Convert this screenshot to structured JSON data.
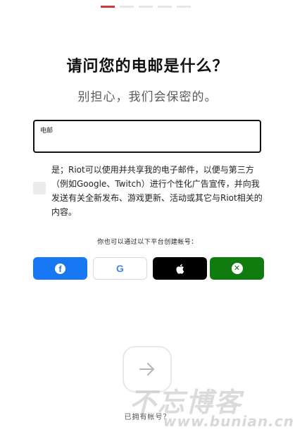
{
  "progress": {
    "total_steps": 5,
    "current_step": 1
  },
  "header": {
    "title": "请问您的电邮是什么？",
    "subtitle": "别担心，我们会保密的。"
  },
  "email": {
    "label": "电邮",
    "value": ""
  },
  "consent": {
    "checked": false,
    "text": "是；Riot可以使用并共享我的电子邮件，以便与第三方（例如Google、Twitch）进行个性化广告宣传，并向我发送有关全新发布、游戏更新、活动或其它与Riot相关的内容。"
  },
  "social": {
    "label": "你也可以通过以下平台创建帐号：",
    "providers": [
      {
        "name": "facebook",
        "icon": "facebook-icon",
        "color": "#1877f2"
      },
      {
        "name": "google",
        "icon": "google-icon",
        "color": "#ffffff"
      },
      {
        "name": "apple",
        "icon": "apple-icon",
        "color": "#000000"
      },
      {
        "name": "xbox",
        "icon": "xbox-icon",
        "color": "#107c10"
      }
    ]
  },
  "next_button": {
    "icon": "arrow-right-icon"
  },
  "footer": {
    "signin_text": "已拥有帐号？"
  },
  "watermark": {
    "line1": "不忘博客",
    "line2": "www.bunian.cn"
  },
  "colors": {
    "accent": "#d13639",
    "text": "#111111",
    "muted": "#5b5b5b"
  }
}
